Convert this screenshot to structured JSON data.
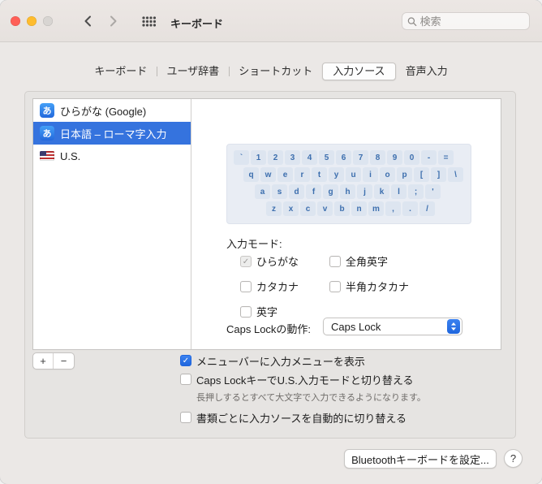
{
  "titlebar": {
    "title": "キーボード",
    "search_placeholder": "検索"
  },
  "tabs": {
    "items": [
      {
        "label": "キーボード",
        "selected": false
      },
      {
        "label": "ユーザ辞書",
        "selected": false
      },
      {
        "label": "ショートカット",
        "selected": false
      },
      {
        "label": "入力ソース",
        "selected": true
      },
      {
        "label": "音声入力",
        "selected": false
      }
    ]
  },
  "source_list": {
    "items": [
      {
        "label": "ひらがな (Google)",
        "icon": "kana-a-icon",
        "badge": "あ",
        "selected": false
      },
      {
        "label": "日本語 – ローマ字入力",
        "icon": "kana-a-icon",
        "badge": "あ",
        "selected": true
      },
      {
        "label": "U.S.",
        "icon": "us-flag-icon",
        "selected": false
      }
    ]
  },
  "keyboard": {
    "rows": [
      {
        "indent": 0,
        "keys": [
          "`",
          "1",
          "2",
          "3",
          "4",
          "5",
          "6",
          "7",
          "8",
          "9",
          "0",
          "-",
          "="
        ]
      },
      {
        "indent": 12,
        "keys": [
          "q",
          "w",
          "e",
          "r",
          "t",
          "y",
          "u",
          "i",
          "o",
          "p",
          "[",
          "]",
          "\\"
        ]
      },
      {
        "indent": 26,
        "keys": [
          "a",
          "s",
          "d",
          "f",
          "g",
          "h",
          "j",
          "k",
          "l",
          ";",
          "'"
        ]
      },
      {
        "indent": 40,
        "keys": [
          "z",
          "x",
          "c",
          "v",
          "b",
          "n",
          "m",
          ",",
          ".",
          "/"
        ]
      }
    ]
  },
  "detail": {
    "input_mode_label": "入力モード:",
    "modes": {
      "hiragana": {
        "label": "ひらがな",
        "checked": true,
        "disabled": true
      },
      "katakana": {
        "label": "カタカナ",
        "checked": false
      },
      "eiji": {
        "label": "英字",
        "checked": false
      },
      "zenkaku_eiji": {
        "label": "全角英字",
        "checked": false
      },
      "hankaku_katakana": {
        "label": "半角カタカナ",
        "checked": false
      }
    },
    "caps_lock_label": "Caps Lockの動作:",
    "caps_lock_value": "Caps Lock"
  },
  "list_controls": {
    "add": "+",
    "remove": "−"
  },
  "options": {
    "menu_bar": {
      "label": "メニューバーに入力メニューを表示",
      "checked": true
    },
    "caps_lock_switch": {
      "label": "Caps LockキーでU.S.入力モードと切り替える",
      "checked": false
    },
    "caps_lock_note": "長押しするとすべて大文字で入力できるようになります。",
    "auto_switch": {
      "label": "書類ごとに入力ソースを自動的に切り替える",
      "checked": false
    }
  },
  "footer": {
    "bluetooth_button": "Bluetoothキーボードを設定...",
    "help_button": "?"
  }
}
